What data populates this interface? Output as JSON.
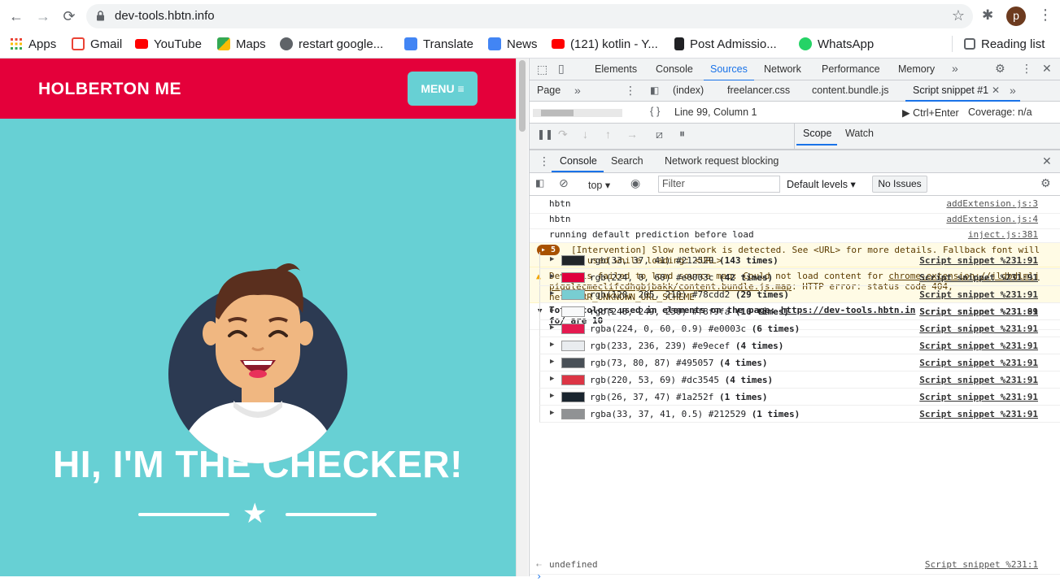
{
  "browser": {
    "url": "dev-tools.hbtn.info",
    "avatar_letter": "p",
    "bookmarks": [
      {
        "label": "Apps",
        "color": "#ea4335"
      },
      {
        "label": "Gmail",
        "color": "#ea4335"
      },
      {
        "label": "YouTube",
        "color": "#ff0000"
      },
      {
        "label": "Maps",
        "color": "#34a853"
      },
      {
        "label": "restart google...",
        "color": "#5f6368"
      },
      {
        "label": "Translate",
        "color": "#4285f4"
      },
      {
        "label": "News",
        "color": "#4285f4"
      },
      {
        "label": "(121) kotlin - Y...",
        "color": "#ff0000"
      },
      {
        "label": "Post Admissio...",
        "color": "#202124"
      },
      {
        "label": "WhatsApp",
        "color": "#25d366"
      }
    ],
    "reading_list": "Reading list"
  },
  "site": {
    "brand": "HOLBERTON ME",
    "menu_label": "MENU ≡",
    "hero_title": "HI, I'M THE CHECKER!",
    "colors": {
      "header": "#e4003a",
      "bg": "#67d0d4"
    }
  },
  "devtools": {
    "tabs": [
      "Elements",
      "Console",
      "Sources",
      "Network",
      "Performance",
      "Memory"
    ],
    "active_tab": "Sources",
    "page_tab": "Page",
    "files": [
      "(index)",
      "freelancer.css",
      "content.bundle.js",
      "Script snippet #1"
    ],
    "position": "Line 99, Column 1",
    "run_hint": "Ctrl+Enter",
    "coverage": "Coverage: n/a",
    "scope_tab": "Scope",
    "watch_tab": "Watch",
    "drawer_tabs": [
      "Console",
      "Search",
      "Network request blocking"
    ],
    "context": "top",
    "filter_placeholder": "Filter",
    "levels": "Default levels",
    "issues": "No Issues"
  },
  "console": {
    "logs": [
      {
        "text": "hbtn",
        "source": "addExtension.js:3"
      },
      {
        "text": "hbtn",
        "source": "addExtension.js:4"
      },
      {
        "text": "running default prediction before load",
        "source": "inject.js:381"
      }
    ],
    "intervention_count": "5",
    "intervention_line1": "[Intervention] Slow network is detected. See <URL> for more details. Fallback font will",
    "intervention_line2": "be used while loading: <URL>",
    "warn_line1a": "DevTools failed to load source map: Could not load content for ",
    "warn_line1b": "chrome-extension://jldbdlmlj",
    "warn_line2a": "pigglecmeclifcdhgbjbakk/content.bundle.js.map",
    "warn_line2b": ": HTTP error: status code 404,",
    "warn_line3": "net::ERR_UNKNOWN_URL_SCHEME",
    "group_prefix": "Total colors used in elements on the page: ",
    "group_url1": "https://dev-tools.hbtn.in",
    "group_url2": "fo/",
    "group_suffix": " are 10",
    "group_source": "Script snippet %231:89",
    "colors": [
      {
        "rgb": "rgb(33, 37, 41)",
        "hex": "#212529",
        "count": "(143 times)",
        "swatch": "#212529"
      },
      {
        "rgb": "rgb(224, 0, 60)",
        "hex": "#e0003c",
        "count": "(42 times)",
        "swatch": "#e0003c"
      },
      {
        "rgb": "rgb(120, 205, 210)",
        "hex": "#78cdd2",
        "count": "(29 times)",
        "swatch": "#78cdd2"
      },
      {
        "rgb": "rgb(248, 249, 250)",
        "hex": "#f8f9fa",
        "count": "(10 times)",
        "swatch": "#f8f9fa"
      },
      {
        "rgb": "rgba(224, 0, 60, 0.9)",
        "hex": "#e0003c",
        "count": "(6 times)",
        "swatch": "#e51a50"
      },
      {
        "rgb": "rgb(233, 236, 239)",
        "hex": "#e9ecef",
        "count": "(4 times)",
        "swatch": "#e9ecef"
      },
      {
        "rgb": "rgb(73, 80, 87)",
        "hex": "#495057",
        "count": "(4 times)",
        "swatch": "#495057"
      },
      {
        "rgb": "rgb(220, 53, 69)",
        "hex": "#dc3545",
        "count": "(4 times)",
        "swatch": "#dc3545"
      },
      {
        "rgb": "rgb(26, 37, 47)",
        "hex": "#1a252f",
        "count": "(1 times)",
        "swatch": "#1a252f"
      },
      {
        "rgb": "rgba(33, 37, 41, 0.5)",
        "hex": "#212529",
        "count": "(1 times)",
        "swatch": "#909294"
      }
    ],
    "color_source": "Script snippet %231:91",
    "result": "undefined",
    "result_source": "Script snippet %231:1"
  }
}
